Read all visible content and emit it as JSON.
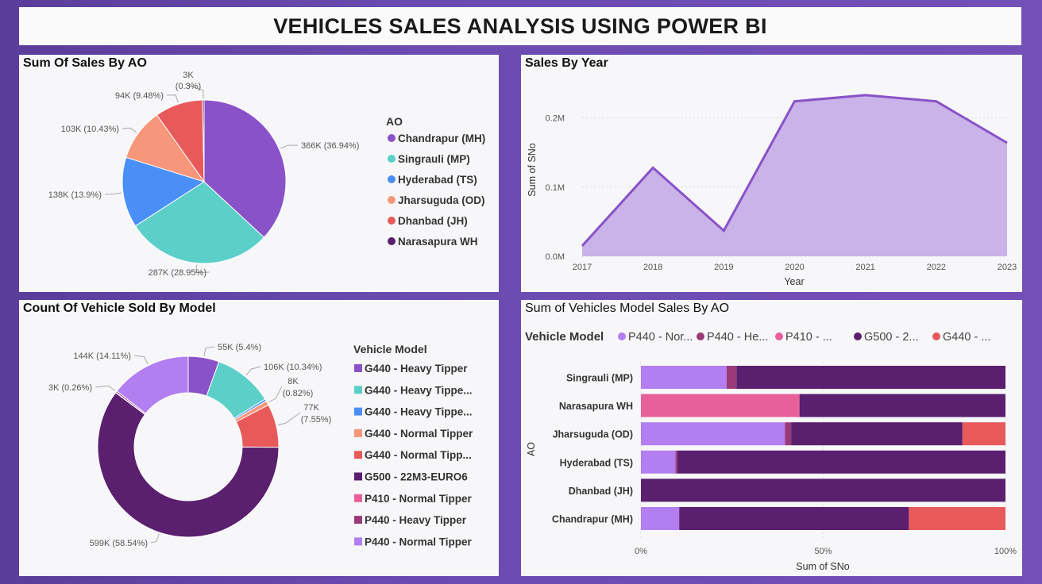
{
  "dashboard": {
    "title": "VEHICLES SALES ANALYSIS USING POWER BI"
  },
  "colors": {
    "purple": "#8a52c8",
    "teal": "#5ccfc9",
    "blue": "#4a8ff7",
    "salmon": "#f7967a",
    "red": "#e85a5a",
    "darkpurple": "#5a1f6e",
    "pink": "#e8609a",
    "plum": "#9b3a78",
    "lavender": "#b27ef0"
  },
  "pie": {
    "title": "Sum Of Sales By AO",
    "legend_title": "AO",
    "slices": [
      {
        "name": "Chandrapur (MH)",
        "value": 366,
        "label": "366K (36.94%)",
        "color": "#8a52c8"
      },
      {
        "name": "Singrauli (MP)",
        "value": 287,
        "label": "287K (28.95%)",
        "color": "#5ccfc9"
      },
      {
        "name": "Hyderabad (TS)",
        "value": 138,
        "label": "138K (13.9%)",
        "color": "#4a8ff7"
      },
      {
        "name": "Jharsuguda (OD)",
        "value": 103,
        "label": "103K (10.43%)",
        "color": "#f7967a"
      },
      {
        "name": "Dhanbad (JH)",
        "value": 94,
        "label": "94K (9.48%)",
        "color": "#e85a5a"
      },
      {
        "name": "Narasapura WH",
        "value": 3,
        "label_line1": "3K",
        "label_line2": "(0.3%)",
        "color": "#5a1f6e"
      }
    ]
  },
  "area": {
    "title": "Sales By Year",
    "xlabel": "Year",
    "ylabel": "Sum of SNo",
    "y_ticks": [
      "0.0M",
      "0.1M",
      "0.2M"
    ]
  },
  "donut": {
    "title": "Count Of Vehicle Sold By Model",
    "legend_title": "Vehicle Model",
    "slices": [
      {
        "name": "G440 - Heavy Tipper",
        "value": 55,
        "label": "55K (5.4%)",
        "color": "#8a52c8"
      },
      {
        "name": "G440 - Heavy Tippe...",
        "value": 106,
        "label": "106K (10.34%)",
        "color": "#5ccfc9"
      },
      {
        "name": "G440 - Heavy Tippe...",
        "value": 4,
        "label": "",
        "color": "#4a8ff7"
      },
      {
        "name": "G440 - Normal Tipper",
        "value": 8,
        "label_line1": "8K",
        "label_line2": "(0.82%)",
        "color": "#f7967a"
      },
      {
        "name": "G440 - Normal Tipp...",
        "value": 77,
        "label_line1": "77K",
        "label_line2": "(7.55%)",
        "color": "#e85a5a"
      },
      {
        "name": "G500 - 22M3-EURO6",
        "value": 599,
        "label": "599K (58.54%)",
        "color": "#5a1f6e"
      },
      {
        "name": "P410 - Normal Tipper",
        "value": 0.5,
        "label": "",
        "color": "#e8609a"
      },
      {
        "name": "P440 - Heavy Tipper",
        "value": 3,
        "label": "3K (0.26%)",
        "color": "#9b3a78"
      },
      {
        "name": "P440 - Normal Tipper",
        "value": 144,
        "label": "144K (14.11%)",
        "color": "#b27ef0"
      }
    ]
  },
  "bars": {
    "title": "Sum of Vehicles Model Sales By AO",
    "legend_title": "Vehicle Model",
    "legend": [
      {
        "name": "P440 - Nor...",
        "color": "#b27ef0"
      },
      {
        "name": "P440 - He...",
        "color": "#9b3a78"
      },
      {
        "name": "P410 - ...",
        "color": "#e8609a"
      },
      {
        "name": "G500 - 2...",
        "color": "#5a1f6e"
      },
      {
        "name": "G440 - ...",
        "color": "#e85a5a"
      }
    ],
    "ylabel": "AO",
    "xlabel": "Sum of SNo",
    "x_ticks": [
      "0%",
      "50%",
      "100%"
    ]
  },
  "chart_data": [
    {
      "type": "pie",
      "title": "Sum Of Sales By AO",
      "legend_title": "AO",
      "categories": [
        "Chandrapur (MH)",
        "Singrauli (MP)",
        "Hyderabad (TS)",
        "Jharsuguda (OD)",
        "Dhanbad (JH)",
        "Narasapura WH"
      ],
      "values": [
        366,
        287,
        138,
        103,
        94,
        3
      ],
      "unit": "K",
      "percent": [
        36.94,
        28.95,
        13.9,
        10.43,
        9.48,
        0.3
      ]
    },
    {
      "type": "area",
      "title": "Sales By Year",
      "xlabel": "Year",
      "ylabel": "Sum of SNo",
      "x": [
        2017,
        2018,
        2019,
        2020,
        2021,
        2022,
        2023
      ],
      "values": [
        0.015,
        0.128,
        0.037,
        0.224,
        0.233,
        0.224,
        0.164
      ],
      "unit": "M",
      "ylim": [
        0,
        0.25
      ],
      "yticks": [
        0,
        0.1,
        0.2
      ]
    },
    {
      "type": "pie",
      "title": "Count Of Vehicle Sold By Model",
      "legend_title": "Vehicle Model",
      "categories": [
        "G440 - Heavy Tipper",
        "G440 - Heavy Tippe...",
        "G440 - Heavy Tippe...",
        "G440 - Normal Tipper",
        "G440 - Normal Tipp...",
        "G500 - 22M3-EURO6",
        "P410 - Normal Tipper",
        "P440 - Heavy Tipper",
        "P440 - Normal Tipper"
      ],
      "values": [
        55,
        106,
        4,
        8,
        77,
        599,
        0.5,
        3,
        144
      ],
      "unit": "K",
      "percent": [
        5.4,
        10.34,
        null,
        0.82,
        7.55,
        58.54,
        null,
        0.26,
        14.11
      ]
    },
    {
      "type": "bar",
      "orientation": "horizontal",
      "stacked": "100%",
      "title": "Sum of Vehicles Model Sales By AO",
      "xlabel": "Sum of SNo",
      "ylabel": "AO",
      "categories": [
        "Singrauli (MP)",
        "Narasapura WH",
        "Jharsuguda (OD)",
        "Hyderabad (TS)",
        "Dhanbad (JH)",
        "Chandrapur (MH)"
      ],
      "series": [
        {
          "name": "P440 - Nor...",
          "values": [
            23.5,
            0,
            39.5,
            9.5,
            0,
            10.5
          ]
        },
        {
          "name": "P440 - He...",
          "values": [
            2.7,
            0,
            1.7,
            0.5,
            0,
            0
          ]
        },
        {
          "name": "P410 - ...",
          "values": [
            0,
            43.5,
            0,
            0,
            0,
            0
          ]
        },
        {
          "name": "G500 - 2...",
          "values": [
            73.8,
            56.5,
            47.0,
            90.0,
            100,
            63.0
          ]
        },
        {
          "name": "G440 - ...",
          "values": [
            0,
            0,
            11.8,
            0,
            0,
            26.5
          ]
        }
      ],
      "xlim": [
        0,
        100
      ]
    }
  ]
}
